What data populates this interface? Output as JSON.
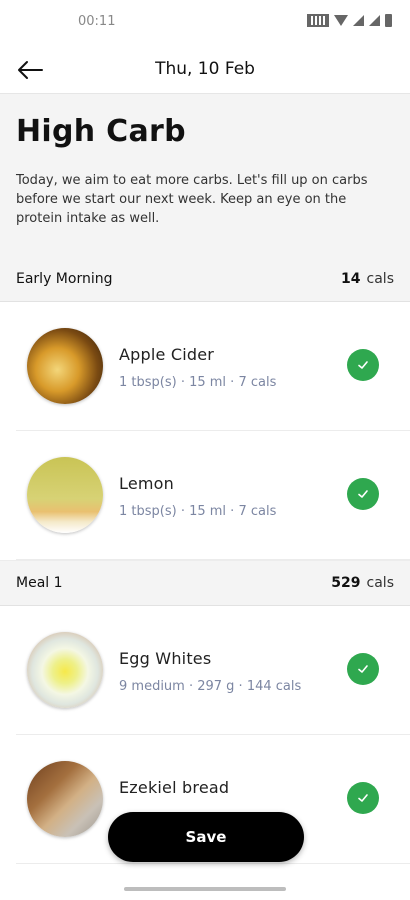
{
  "status_bar": {
    "time": "00:11"
  },
  "header": {
    "title": "Thu, 10 Feb"
  },
  "plan": {
    "title": "High Carb",
    "description": "Today, we aim to eat more carbs. Let's fill up on carbs before we start our next week. Keep an eye on the protein intake as well."
  },
  "sections": [
    {
      "name": "Early Morning",
      "cals_value": "14",
      "cals_unit": "cals",
      "items": [
        {
          "name": "Apple Cider",
          "meta": "1 tbsp(s) · 15 ml · 7 cals"
        },
        {
          "name": "Lemon",
          "meta": "1 tbsp(s) · 15 ml · 7 cals"
        }
      ]
    },
    {
      "name": "Meal 1",
      "cals_value": "529",
      "cals_unit": "cals",
      "items": [
        {
          "name": "Egg Whites",
          "meta": "9 medium · 297 g · 144 cals"
        },
        {
          "name": "Ezekiel bread",
          "meta": ""
        }
      ]
    }
  ],
  "actions": {
    "save_label": "Save"
  },
  "colors": {
    "check_green": "#2fa84f",
    "meta_text": "#7c86a2",
    "hero_bg": "#f4f4f4"
  }
}
